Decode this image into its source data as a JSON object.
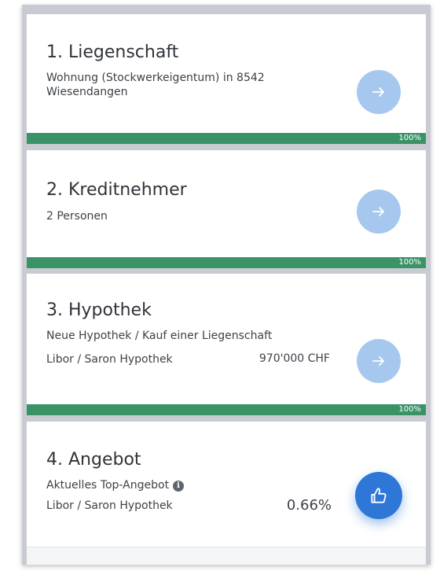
{
  "steps": [
    {
      "title": "1. Liegenschaft",
      "subtitle": "Wohnung (Stockwerkeigentum) in 8542 Wiesendangen",
      "progress": "100%",
      "button_icon": "arrow-right-icon"
    },
    {
      "title": "2. Kreditnehmer",
      "subtitle": "2 Personen",
      "progress": "100%",
      "button_icon": "arrow-right-icon"
    },
    {
      "title": "3. Hypothek",
      "subtitle": "Neue Hypothek / Kauf einer Liegenschaft",
      "product": "Libor / Saron Hypothek",
      "amount": "970'000 CHF",
      "progress": "100%",
      "button_icon": "arrow-right-icon"
    },
    {
      "title": "4. Angebot",
      "subtitle": "Aktuelles Top-Angebot",
      "info_icon": "info-icon",
      "product": "Libor / Saron Hypothek",
      "rate": "0.66%",
      "button_icon": "thumbs-up-icon"
    }
  ],
  "colors": {
    "progress_bar": "#3a9367",
    "button_light": "#a6c8ef",
    "button_primary": "#2e77d6"
  }
}
